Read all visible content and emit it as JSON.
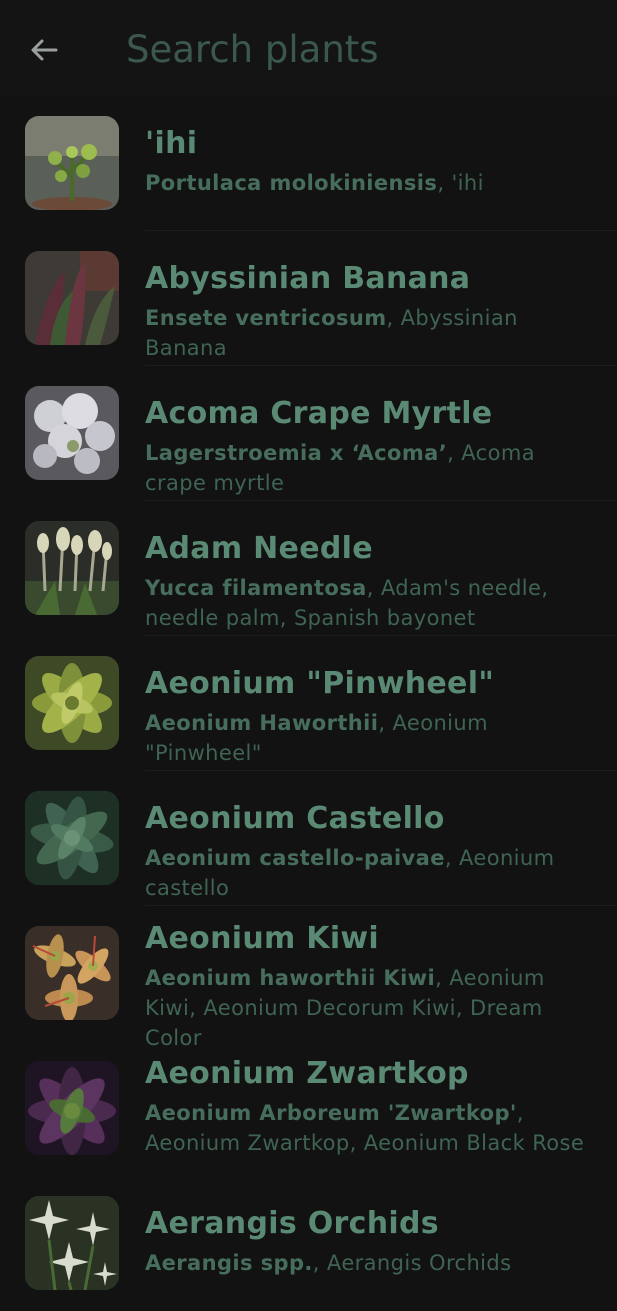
{
  "header": {
    "search_placeholder": "Search plants"
  },
  "plants": [
    {
      "name": "'ihi",
      "scientific": "Portulaca molokiniensis",
      "common": ", 'ihi"
    },
    {
      "name": "Abyssinian Banana",
      "scientific": "Ensete ventricosum",
      "common": ", Abyssinian Banana"
    },
    {
      "name": "Acoma Crape Myrtle",
      "scientific": "Lagerstroemia x ‘Acoma’",
      "common": ", Acoma crape myrtle"
    },
    {
      "name": "Adam Needle",
      "scientific": "Yucca filamentosa",
      "common": ", Adam's needle, needle palm, Spanish bayonet"
    },
    {
      "name": "Aeonium \"Pinwheel\"",
      "scientific": "Aeonium Haworthii",
      "common": ", Aeonium \"Pinwheel\""
    },
    {
      "name": "Aeonium Castello",
      "scientific": "Aeonium castello-paivae",
      "common": ", Aeonium castello"
    },
    {
      "name": "Aeonium Kiwi",
      "scientific": "Aeonium haworthii Kiwi",
      "common": ", Aeonium Kiwi, Aeonium Decorum Kiwi, Dream Color"
    },
    {
      "name": "Aeonium Zwartkop",
      "scientific": "Aeonium Arboreum 'Zwartkop'",
      "common": ", Aeonium Zwartkop, Aeonium Black Rose"
    },
    {
      "name": "Aerangis Orchids",
      "scientific": "Aerangis spp.",
      "common": ", Aerangis Orchids"
    }
  ]
}
